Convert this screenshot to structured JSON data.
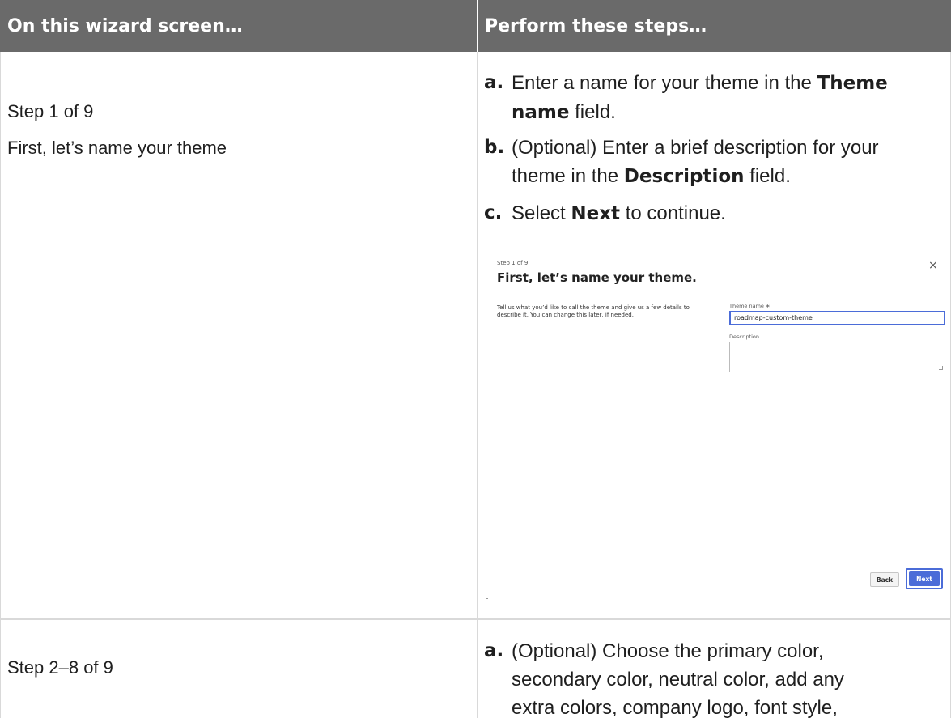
{
  "header": {
    "col1": "On this wizard screen…",
    "col2": "Perform these steps…"
  },
  "row1": {
    "left": {
      "step": "Step 1 of 9",
      "title": "First, let’s name your theme"
    },
    "steps": {
      "a": {
        "label": "a.",
        "pre": "Enter a name for your theme in the ",
        "bold1": "Theme",
        "bold2": "name",
        "post": " field."
      },
      "b": {
        "label": "b.",
        "pre": "(Optional) Enter a brief description for your",
        "line2_pre": "theme in the ",
        "bold": "Description",
        "post": " field."
      },
      "c": {
        "label": "c.",
        "pre": "Select ",
        "bold": "Next",
        "post": " to continue."
      }
    },
    "screenshot": {
      "step_label": "Step 1 of 9",
      "title": "First, let’s name your theme.",
      "close_glyph": "×",
      "description": "Tell us what you’d like to call the theme and give us a few details to describe it. You can change this later, if needed.",
      "theme_name_label": "Theme name ∗",
      "theme_name_value": "roadmap-custom-theme",
      "description_label": "Description",
      "description_value": "",
      "back_label": "Back",
      "next_label": "Next",
      "accent_color": "#4b6cd8"
    }
  },
  "row2": {
    "left": {
      "step": "Step 2–8 of 9"
    },
    "steps": {
      "a": {
        "label": "a.",
        "line1": "(Optional) Choose the primary color,",
        "line2": "secondary color, neutral color, add any",
        "line3": "extra colors, company logo, font style,"
      }
    }
  },
  "colors": {
    "header_bg": "#6a6a6a",
    "grid_line": "#d9d9d9"
  }
}
